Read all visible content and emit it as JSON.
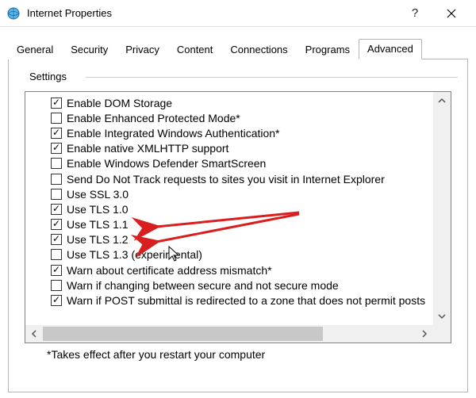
{
  "window": {
    "title": "Internet Properties"
  },
  "tabs": [
    {
      "label": "General"
    },
    {
      "label": "Security"
    },
    {
      "label": "Privacy"
    },
    {
      "label": "Content"
    },
    {
      "label": "Connections"
    },
    {
      "label": "Programs"
    },
    {
      "label": "Advanced",
      "active": true
    }
  ],
  "group": {
    "label": "Settings"
  },
  "settings": [
    {
      "label": "Enable DOM Storage",
      "checked": true
    },
    {
      "label": "Enable Enhanced Protected Mode*",
      "checked": false
    },
    {
      "label": "Enable Integrated Windows Authentication*",
      "checked": true
    },
    {
      "label": "Enable native XMLHTTP support",
      "checked": true
    },
    {
      "label": "Enable Windows Defender SmartScreen",
      "checked": false
    },
    {
      "label": "Send Do Not Track requests to sites you visit in Internet Explorer",
      "checked": false
    },
    {
      "label": "Use SSL 3.0",
      "checked": false
    },
    {
      "label": "Use TLS 1.0",
      "checked": true
    },
    {
      "label": "Use TLS 1.1",
      "checked": true
    },
    {
      "label": "Use TLS 1.2",
      "checked": true
    },
    {
      "label": "Use TLS 1.3 (experimental)",
      "checked": false
    },
    {
      "label": "Warn about certificate address mismatch*",
      "checked": true
    },
    {
      "label": "Warn if changing between secure and not secure mode",
      "checked": false
    },
    {
      "label": "Warn if POST submittal is redirected to a zone that does not permit posts",
      "checked": true
    }
  ],
  "footnote": "*Takes effect after you restart your computer",
  "annotation": {
    "color": "#d81e1e"
  }
}
